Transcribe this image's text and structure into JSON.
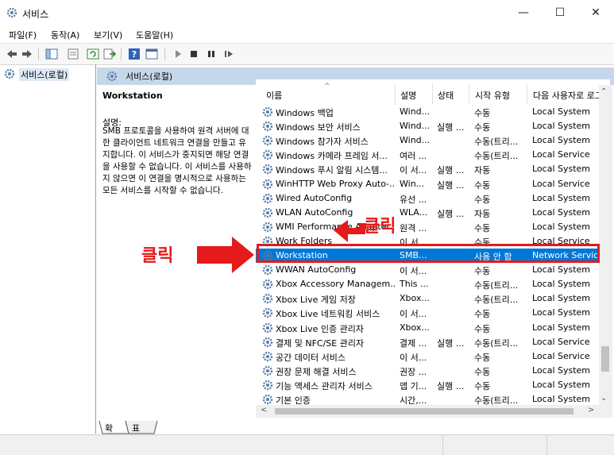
{
  "window": {
    "title": "서비스",
    "minimize": "—",
    "maximize": "☐",
    "close": "✕"
  },
  "menu": [
    "파일(F)",
    "동작(A)",
    "보기(V)",
    "도움말(H)"
  ],
  "tree": {
    "root_label": "서비스(로컬)"
  },
  "pane": {
    "header": "서비스(로컬)",
    "selected_title": "Workstation",
    "desc_label": "설명:",
    "desc_text": "SMB 프로토콜을 사용하여 원격 서버에 대한 클라이언트 네트워크 연결을 만들고 유지합니다. 이 서비스가 중지되면 해당 연결을 사용할 수 없습니다. 이 서비스를 사용하지 않으면 이 연결을 명시적으로 사용하는 모든 서비스를 시작할 수 없습니다."
  },
  "columns": {
    "name": "이름",
    "desc": "설명",
    "state": "상태",
    "start": "시작 유형",
    "logon": "다음 사용자로 로그온"
  },
  "rows": [
    {
      "name": "Windows 백업",
      "desc": "Wind...",
      "state": "",
      "start": "수동",
      "logon": "Local System"
    },
    {
      "name": "Windows 보안 서비스",
      "desc": "Wind...",
      "state": "실행 ...",
      "start": "수동",
      "logon": "Local System"
    },
    {
      "name": "Windows 참가자 서비스",
      "desc": "Wind...",
      "state": "",
      "start": "수동(트리...",
      "logon": "Local System"
    },
    {
      "name": "Windows 카메라 프레임 서...",
      "desc": "여러 ...",
      "state": "",
      "start": "수동(트리...",
      "logon": "Local Service"
    },
    {
      "name": "Windows 푸시 알림 시스템...",
      "desc": "이 서...",
      "state": "실행 ...",
      "start": "자동",
      "logon": "Local System"
    },
    {
      "name": "WinHTTP Web Proxy Auto-...",
      "desc": "Win...",
      "state": "실행 ...",
      "start": "수동",
      "logon": "Local Service"
    },
    {
      "name": "Wired AutoConfig",
      "desc": "유선 ...",
      "state": "",
      "start": "수동",
      "logon": "Local System"
    },
    {
      "name": "WLAN AutoConfig",
      "desc": "WLA...",
      "state": "실행 ...",
      "start": "자동",
      "logon": "Local System"
    },
    {
      "name": "WMI Performance Adapter",
      "desc": "원격 ...",
      "state": "",
      "start": "수동",
      "logon": "Local System"
    },
    {
      "name": "Work Folders",
      "desc": "이 서...",
      "state": "",
      "start": "수동",
      "logon": "Local Service"
    },
    {
      "name": "Workstation",
      "desc": "SMB...",
      "state": "",
      "start": "사용 안 함",
      "logon": "Network Service",
      "selected": true
    },
    {
      "name": "WWAN AutoConfig",
      "desc": "이 서...",
      "state": "",
      "start": "수동",
      "logon": "Local System"
    },
    {
      "name": "Xbox Accessory Managem...",
      "desc": "This ...",
      "state": "",
      "start": "수동(트리...",
      "logon": "Local System"
    },
    {
      "name": "Xbox Live 게임 저장",
      "desc": "Xbox...",
      "state": "",
      "start": "수동(트리...",
      "logon": "Local System"
    },
    {
      "name": "Xbox Live 네트워킹 서비스",
      "desc": "이 서...",
      "state": "",
      "start": "수동",
      "logon": "Local System"
    },
    {
      "name": "Xbox Live 인증 관리자",
      "desc": "Xbox...",
      "state": "",
      "start": "수동",
      "logon": "Local System"
    },
    {
      "name": "결제 및 NFC/SE 관리자",
      "desc": "결제 ...",
      "state": "실행 ...",
      "start": "수동(트리...",
      "logon": "Local Service"
    },
    {
      "name": "공간 데이터 서비스",
      "desc": "이 서...",
      "state": "",
      "start": "수동",
      "logon": "Local Service"
    },
    {
      "name": "권장 문제 해결 서비스",
      "desc": "권장 ...",
      "state": "",
      "start": "수동",
      "logon": "Local System"
    },
    {
      "name": "기능 액세스 관리자 서비스",
      "desc": "앱 기...",
      "state": "실행 ...",
      "start": "수동",
      "logon": "Local System"
    },
    {
      "name": "기본 인증",
      "desc": "시간,...",
      "state": "",
      "start": "수동(트리...",
      "logon": "Local System"
    }
  ],
  "tabs": {
    "extended": "확장",
    "standard": "표준"
  },
  "annotations": {
    "click_left": "클릭",
    "click_top": "클릭"
  },
  "colors": {
    "selection": "#0078d7",
    "annotation_red": "#e51a1a",
    "header_strip": "#c7d7ea"
  }
}
